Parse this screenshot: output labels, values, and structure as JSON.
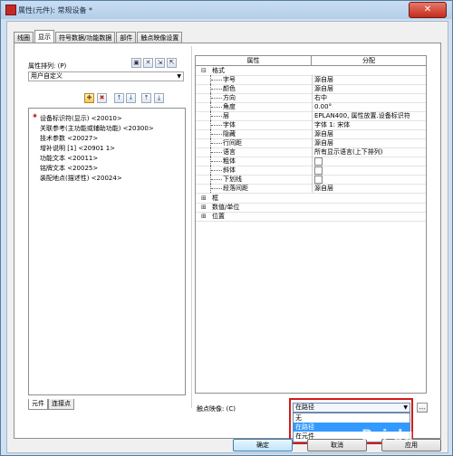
{
  "window": {
    "title": "属性(元件): 常规设备 *",
    "close_glyph": "✕"
  },
  "tabs": [
    {
      "label": "线圈"
    },
    {
      "label": "显示"
    },
    {
      "label": "符号数据/功能数据"
    },
    {
      "label": "部件"
    },
    {
      "label": "触点映像设置"
    }
  ],
  "left": {
    "sort_label": "属性排列: (P)",
    "sort_value": "用户自定义",
    "items": [
      "设备标识符(显示) <20010>",
      "关联参考(主功能或辅助功能) <20300>",
      "技术参数 <20027>",
      "增补说明 [1] <20901 1>",
      "功能文本 <20011>",
      "铭牌文本 <20025>",
      "装配地点(描述性) <20024>"
    ],
    "bottom_tabs": [
      "元件",
      "连接点"
    ]
  },
  "grid": {
    "col_property": "属性",
    "col_assignment": "分配",
    "groups": {
      "format": "格式",
      "frame": "框",
      "values_units": "数值/单位",
      "position": "位置"
    },
    "rows": [
      {
        "name": "字号",
        "value": "源自层"
      },
      {
        "name": "颜色",
        "value": "源自层"
      },
      {
        "name": "方向",
        "value": "右中"
      },
      {
        "name": "角度",
        "value": "0.00°"
      },
      {
        "name": "层",
        "value": "EPLAN400, 属性放置.设备标识符"
      },
      {
        "name": "字体",
        "value": "字体 1: 宋体"
      },
      {
        "name": "隐藏",
        "value": "源自层"
      },
      {
        "name": "行间距",
        "value": "源自层"
      },
      {
        "name": "语言",
        "value": "所有显示语言(上下排列)"
      },
      {
        "name": "粗体",
        "value": ""
      },
      {
        "name": "斜体",
        "value": ""
      },
      {
        "name": "下划线",
        "value": ""
      },
      {
        "name": "段落间距",
        "value": "源自层"
      }
    ]
  },
  "contact_image": {
    "label": "触点映像: (C)",
    "selected": "在路径",
    "options": [
      "无",
      "在路径",
      "在元件"
    ],
    "more": "..."
  },
  "buttons": {
    "ok": "确定",
    "cancel": "取消",
    "apply": "应用"
  },
  "watermark": "Bai du"
}
